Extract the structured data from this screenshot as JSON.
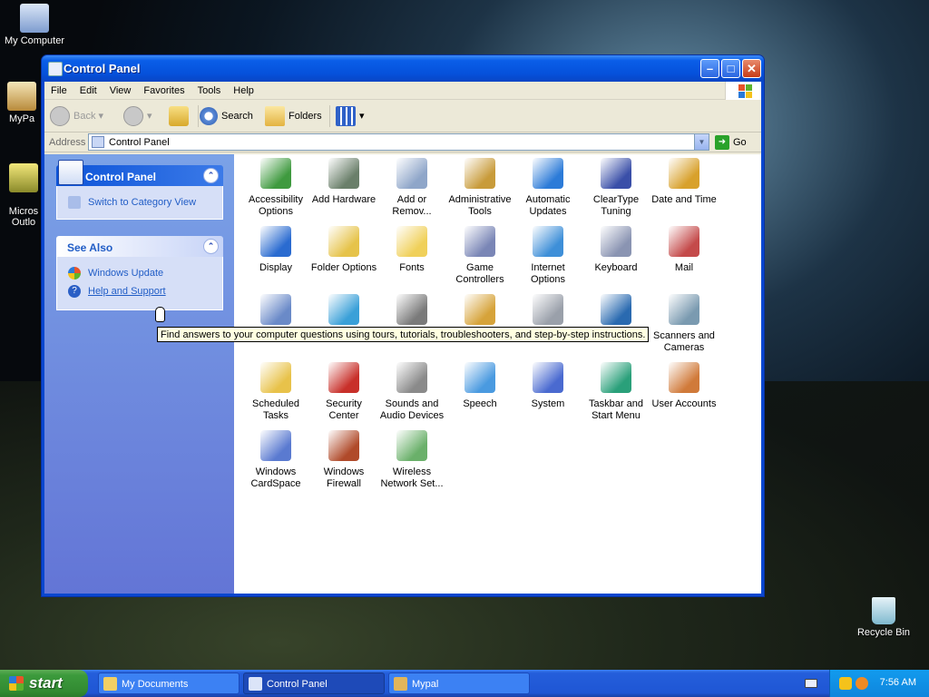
{
  "desktop": {
    "icons": [
      {
        "label": "My Computer",
        "icon": "my-computer-icon"
      },
      {
        "label": "MyPa",
        "icon": "mypal-icon"
      },
      {
        "label": "Micros\nOutlo",
        "icon": "outlook-icon"
      },
      {
        "label": "Recycle Bin",
        "icon": "recycle-bin-icon"
      }
    ]
  },
  "window": {
    "title": "Control Panel",
    "menu": [
      "File",
      "Edit",
      "View",
      "Favorites",
      "Tools",
      "Help"
    ],
    "toolbar": {
      "back": "Back",
      "search": "Search",
      "folders": "Folders"
    },
    "address": {
      "label": "Address",
      "value": "Control Panel",
      "go": "Go"
    }
  },
  "taskpane": {
    "control_panel": {
      "title": "Control Panel",
      "switch": "Switch to Category View"
    },
    "see_also": {
      "title": "See Also",
      "windows_update": "Windows Update",
      "help": "Help and Support"
    }
  },
  "items": [
    {
      "label": "Accessibility Options",
      "icon": "accessibility-icon"
    },
    {
      "label": "Add Hardware",
      "icon": "add-hardware-icon"
    },
    {
      "label": "Add or Remov...",
      "icon": "add-remove-programs-icon"
    },
    {
      "label": "Administrative Tools",
      "icon": "administrative-tools-icon"
    },
    {
      "label": "Automatic Updates",
      "icon": "automatic-updates-icon"
    },
    {
      "label": "ClearType Tuning",
      "icon": "cleartype-icon"
    },
    {
      "label": "Date and Time",
      "icon": "date-time-icon"
    },
    {
      "label": "Display",
      "icon": "display-icon"
    },
    {
      "label": "Folder Options",
      "icon": "folder-options-icon"
    },
    {
      "label": "Fonts",
      "icon": "fonts-icon"
    },
    {
      "label": "Game Controllers",
      "icon": "game-controllers-icon"
    },
    {
      "label": "Internet Options",
      "icon": "internet-options-icon"
    },
    {
      "label": "Keyboard",
      "icon": "keyboard-icon"
    },
    {
      "label": "Mail",
      "icon": "mail-icon"
    },
    {
      "label": "",
      "icon": "mouse-icon"
    },
    {
      "label": "Connections",
      "icon": "network-connections-icon"
    },
    {
      "label": "Modem ...",
      "icon": "phone-modem-icon"
    },
    {
      "label": "",
      "icon": "power-options-icon"
    },
    {
      "label": "Faxes",
      "icon": "printers-faxes-icon"
    },
    {
      "label": "Language ...",
      "icon": "regional-language-icon"
    },
    {
      "label": "Scanners and Cameras",
      "icon": "scanners-cameras-icon"
    },
    {
      "label": "Scheduled Tasks",
      "icon": "scheduled-tasks-icon"
    },
    {
      "label": "Security Center",
      "icon": "security-center-icon"
    },
    {
      "label": "Sounds and Audio Devices",
      "icon": "sounds-icon"
    },
    {
      "label": "Speech",
      "icon": "speech-icon"
    },
    {
      "label": "System",
      "icon": "system-icon"
    },
    {
      "label": "Taskbar and Start Menu",
      "icon": "taskbar-start-menu-icon"
    },
    {
      "label": "User Accounts",
      "icon": "user-accounts-icon"
    },
    {
      "label": "Windows CardSpace",
      "icon": "cardspace-icon"
    },
    {
      "label": "Windows Firewall",
      "icon": "firewall-icon"
    },
    {
      "label": "Wireless Network Set...",
      "icon": "wireless-network-icon"
    }
  ],
  "tooltip": "Find answers to your computer questions using tours, tutorials, troubleshooters, and step-by-step instructions.",
  "taskbar": {
    "start": "start",
    "tasks": [
      "My Documents",
      "Control Panel",
      "Mypal"
    ],
    "clock": "7:56 AM"
  }
}
